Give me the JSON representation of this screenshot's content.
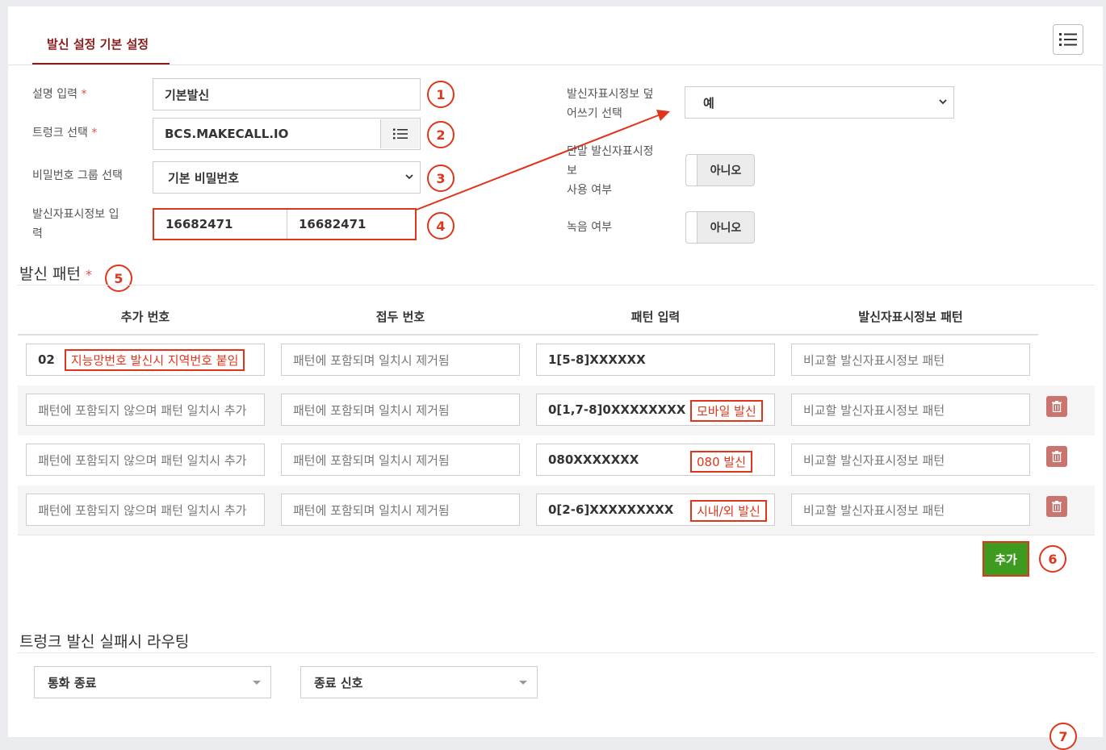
{
  "tab": {
    "label": "발신 설정 기본 설정"
  },
  "form": {
    "description": {
      "label": "설명 입력",
      "required": "*",
      "value": "기본발신",
      "marker": "1"
    },
    "trunk": {
      "label": "트렁크 선택",
      "required": "*",
      "value": "BCS.MAKECALL.IO",
      "marker": "2"
    },
    "password_group": {
      "label": "비밀번호 그룹 선택",
      "value": "기본 비밀번호",
      "marker": "3"
    },
    "caller_id": {
      "label_line1": "발신자표시정보 입",
      "label_line2": "력",
      "value1": "16682471",
      "value2": "16682471",
      "marker": "4"
    },
    "caller_id_overwrite": {
      "label_line1": "발신자표시정보 덮",
      "label_line2": "어쓰기 선택",
      "value": "예"
    },
    "terminal_caller_id": {
      "label_line1": "단말 발신자표시정",
      "label_line2": "보",
      "label_line3": "사용 여부",
      "value": "아니오"
    },
    "recording": {
      "label": "녹음 여부",
      "value": "아니오"
    }
  },
  "patterns": {
    "title": "발신 패턴",
    "required": "*",
    "marker": "5",
    "headers": [
      "추가 번호",
      "접두 번호",
      "패턴 입력",
      "발신자표시정보 패턴"
    ],
    "rows": [
      {
        "add": "02",
        "add_tag": "지능망번호 발신시 지역번호 붙임",
        "prefix_placeholder": "패턴에 포함되며 일치시 제거됨",
        "pattern": "1[5-8]XXXXXX",
        "pattern_tag": "",
        "cid_placeholder": "비교할 발신자표시정보 패턴"
      },
      {
        "add_placeholder": "패턴에 포함되지 않으며 패턴 일치시 추가",
        "prefix_placeholder": "패턴에 포함되며 일치시 제거됨",
        "pattern": "0[1,7-8]0XXXXXXXX",
        "pattern_tag": "모바일 발신",
        "cid_placeholder": "비교할 발신자표시정보 패턴"
      },
      {
        "add_placeholder": "패턴에 포함되지 않으며 패턴 일치시 추가",
        "prefix_placeholder": "패턴에 포함되며 일치시 제거됨",
        "pattern": "080XXXXXXX",
        "pattern_tag": "080 발신",
        "cid_placeholder": "비교할 발신자표시정보 패턴"
      },
      {
        "add_placeholder": "패턴에 포함되지 않으며 패턴 일치시 추가",
        "prefix_placeholder": "패턴에 포함되며 일치시 제거됨",
        "pattern": "0[2-6]XXXXXXXXX",
        "pattern_tag": "시내/외 발신",
        "cid_placeholder": "비교할 발신자표시정보 패턴"
      }
    ],
    "add_button": "추가",
    "add_marker": "6"
  },
  "failover": {
    "title": "트렁크 발신 실패시 라우팅",
    "action": "통화 종료",
    "signal": "종료 신호",
    "marker": "7"
  },
  "icons": {
    "menu": "list-icon",
    "trunk_picker": "list-icon",
    "delete": "trash-icon"
  },
  "colors": {
    "accent": "#8b1a1a",
    "annotation": "#e0351b",
    "add_button": "#3f9b1f",
    "delete_button": "#c9746e"
  }
}
